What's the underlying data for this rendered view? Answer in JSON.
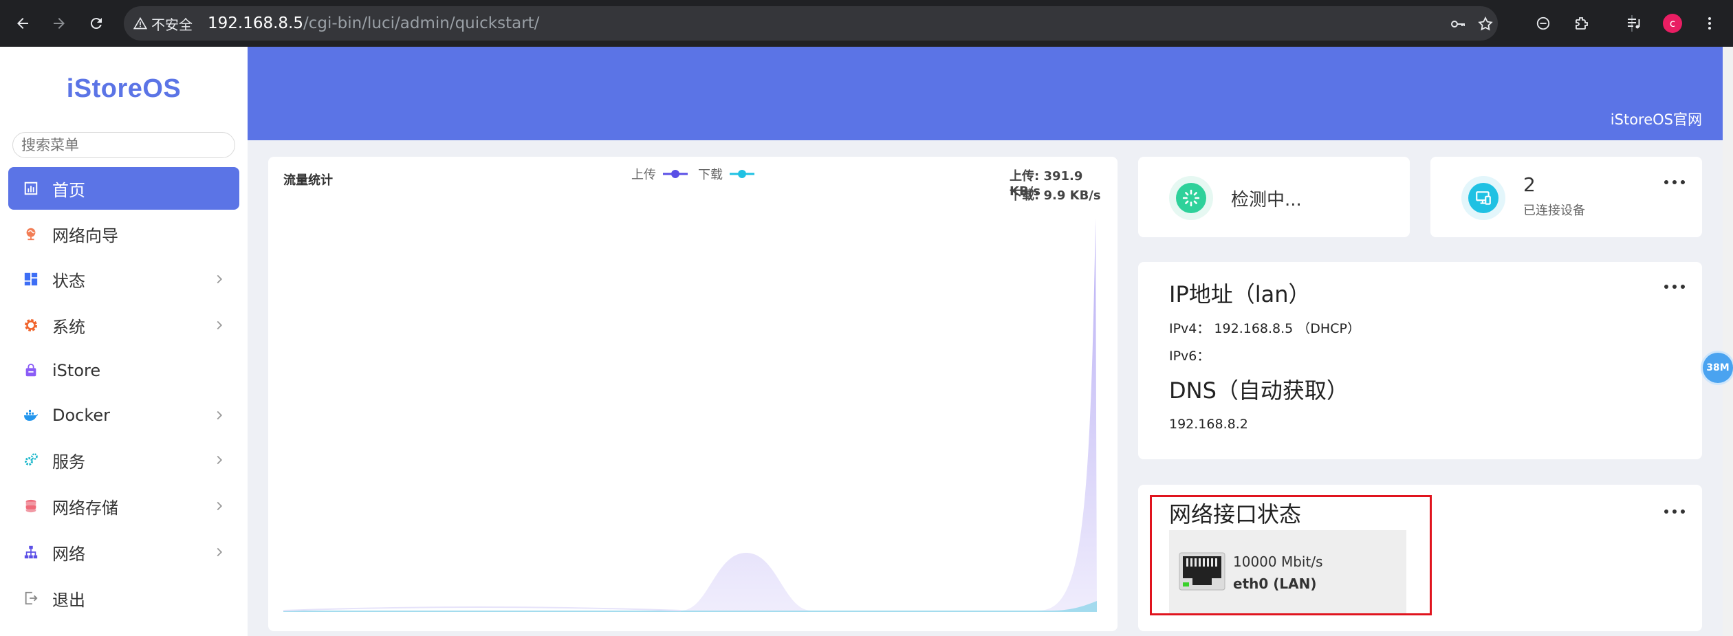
{
  "browser": {
    "security_label": "不安全",
    "url_host": "192.168.8.5",
    "url_path": "/cgi-bin/luci/admin/quickstart/",
    "profile_initial": "c"
  },
  "sidebar": {
    "logo": "iStoreOS",
    "search_placeholder": "搜索菜单",
    "items": [
      {
        "label": "首页",
        "icon": "dashboard-icon",
        "active": true
      },
      {
        "label": "网络向导",
        "icon": "globe-pin-icon"
      },
      {
        "label": "状态",
        "icon": "grid-icon",
        "has_submenu": true
      },
      {
        "label": "系统",
        "icon": "gear-icon",
        "has_submenu": true
      },
      {
        "label": "iStore",
        "icon": "store-bag-icon"
      },
      {
        "label": "Docker",
        "icon": "docker-whale-icon",
        "has_submenu": true
      },
      {
        "label": "服务",
        "icon": "cogs-icon",
        "has_submenu": true
      },
      {
        "label": "网络存储",
        "icon": "database-icon",
        "has_submenu": true
      },
      {
        "label": "网络",
        "icon": "network-tree-icon",
        "has_submenu": true
      },
      {
        "label": "退出",
        "icon": "logout-icon"
      }
    ]
  },
  "header": {
    "official_link": "iStoreOS官网"
  },
  "traffic": {
    "title": "流量统计",
    "upload_legend": "上传",
    "download_legend": "下载",
    "upload_speed": "上传: 391.9 KB/s",
    "download_speed": "下载: 9.9 KB/s",
    "colors": {
      "upload": "#5a4fe6",
      "download": "#1fc1e3",
      "fill": "#d9d3f7"
    }
  },
  "status": {
    "checking": "检测中..."
  },
  "devices": {
    "count": "2",
    "label": "已连接设备"
  },
  "ip": {
    "title": "IP地址（lan）",
    "ipv4": "IPv4： 192.168.8.5 （DHCP）",
    "ipv6": "IPv6：",
    "dns_title": "DNS（自动获取）",
    "dns_value": "192.168.8.2"
  },
  "interfaces": {
    "title": "网络接口状态",
    "items": [
      {
        "speed": "10000 Mbit/s",
        "name": "eth0 (LAN)"
      }
    ]
  },
  "float_badge": "38M"
}
